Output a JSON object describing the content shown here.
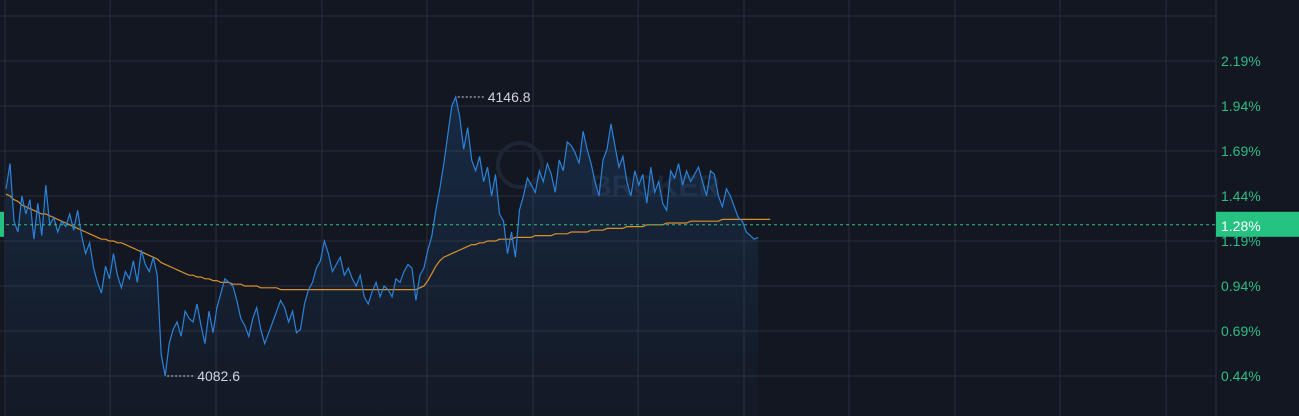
{
  "chart_data": {
    "type": "line",
    "y_unit": "percent change",
    "ylim": [
      0.36,
      2.4
    ],
    "y_ticks": [
      "2.19%",
      "1.94%",
      "1.69%",
      "1.44%",
      "1.19%",
      "0.94%",
      "0.69%",
      "0.44%"
    ],
    "y_tick_values": [
      2.19,
      1.94,
      1.69,
      1.44,
      1.19,
      0.94,
      0.69,
      0.44
    ],
    "current_value_label": "1.28%",
    "current_value": 1.28,
    "annotations": [
      {
        "text": "4146.8",
        "kind": "high",
        "y": 1.99
      },
      {
        "text": "4082.6",
        "kind": "low",
        "y": 0.44
      }
    ],
    "x_steps": 190,
    "grid": true,
    "series": [
      {
        "color": "#2b82d9",
        "values": [
          1.48,
          1.62,
          1.3,
          1.24,
          1.44,
          1.34,
          1.42,
          1.2,
          1.4,
          1.22,
          1.5,
          1.28,
          1.32,
          1.24,
          1.3,
          1.27,
          1.34,
          1.25,
          1.36,
          1.22,
          1.12,
          1.18,
          1.04,
          0.96,
          0.9,
          1.05,
          0.98,
          1.12,
          1.0,
          0.93,
          1.02,
          0.98,
          1.08,
          0.96,
          1.14,
          1.06,
          1.02,
          1.1,
          1.0,
          0.56,
          0.44,
          0.62,
          0.7,
          0.74,
          0.66,
          0.8,
          0.76,
          0.74,
          0.84,
          0.72,
          0.62,
          0.8,
          0.68,
          0.82,
          0.9,
          0.98,
          0.96,
          0.94,
          0.86,
          0.76,
          0.72,
          0.66,
          0.76,
          0.82,
          0.7,
          0.62,
          0.68,
          0.74,
          0.8,
          0.86,
          0.82,
          0.74,
          0.8,
          0.68,
          0.7,
          0.84,
          0.92,
          0.96,
          1.04,
          1.08,
          1.19,
          1.12,
          1.02,
          1.06,
          1.1,
          1.0,
          1.04,
          0.98,
          0.94,
          1.0,
          0.88,
          0.84,
          0.91,
          0.96,
          0.88,
          0.94,
          0.92,
          0.88,
          0.98,
          0.96,
          1.02,
          1.06,
          1.04,
          0.86,
          1.0,
          1.04,
          1.14,
          1.22,
          1.36,
          1.48,
          1.62,
          1.78,
          1.94,
          1.99,
          1.88,
          1.7,
          1.82,
          1.64,
          1.58,
          1.66,
          1.52,
          1.6,
          1.44,
          1.56,
          1.34,
          1.3,
          1.12,
          1.24,
          1.1,
          1.36,
          1.44,
          1.54,
          1.5,
          1.46,
          1.58,
          1.52,
          1.62,
          1.56,
          1.46,
          1.64,
          1.58,
          1.74,
          1.72,
          1.68,
          1.62,
          1.8,
          1.7,
          1.62,
          1.52,
          1.44,
          1.64,
          1.7,
          1.84,
          1.72,
          1.6,
          1.66,
          1.52,
          1.44,
          1.58,
          1.5,
          1.56,
          1.4,
          1.6,
          1.46,
          1.52,
          1.4,
          1.36,
          1.58,
          1.54,
          1.62,
          1.5,
          1.58,
          1.52,
          1.56,
          1.6,
          1.52,
          1.44,
          1.58,
          1.56,
          1.44,
          1.38,
          1.48,
          1.44,
          1.38,
          1.32,
          1.3,
          1.24,
          1.22,
          1.2,
          1.21
        ]
      },
      {
        "color": "#d9902c",
        "values": [
          1.45,
          1.44,
          1.42,
          1.41,
          1.39,
          1.38,
          1.37,
          1.36,
          1.35,
          1.34,
          1.34,
          1.33,
          1.32,
          1.31,
          1.3,
          1.29,
          1.28,
          1.27,
          1.26,
          1.25,
          1.24,
          1.23,
          1.22,
          1.21,
          1.2,
          1.2,
          1.19,
          1.19,
          1.18,
          1.18,
          1.17,
          1.16,
          1.15,
          1.14,
          1.13,
          1.12,
          1.11,
          1.1,
          1.09,
          1.07,
          1.06,
          1.05,
          1.04,
          1.03,
          1.02,
          1.01,
          1.0,
          1.0,
          0.99,
          0.99,
          0.98,
          0.98,
          0.97,
          0.97,
          0.96,
          0.96,
          0.96,
          0.95,
          0.95,
          0.95,
          0.94,
          0.94,
          0.94,
          0.94,
          0.93,
          0.93,
          0.93,
          0.93,
          0.93,
          0.92,
          0.92,
          0.92,
          0.92,
          0.92,
          0.92,
          0.92,
          0.92,
          0.92,
          0.92,
          0.92,
          0.92,
          0.92,
          0.92,
          0.92,
          0.92,
          0.92,
          0.92,
          0.92,
          0.92,
          0.92,
          0.92,
          0.92,
          0.92,
          0.92,
          0.92,
          0.92,
          0.92,
          0.92,
          0.92,
          0.92,
          0.92,
          0.92,
          0.92,
          0.92,
          0.93,
          0.94,
          0.97,
          1.01,
          1.05,
          1.08,
          1.1,
          1.11,
          1.12,
          1.13,
          1.14,
          1.15,
          1.16,
          1.17,
          1.17,
          1.18,
          1.18,
          1.19,
          1.19,
          1.19,
          1.2,
          1.2,
          1.2,
          1.2,
          1.21,
          1.21,
          1.21,
          1.21,
          1.21,
          1.22,
          1.22,
          1.22,
          1.22,
          1.22,
          1.23,
          1.23,
          1.23,
          1.23,
          1.24,
          1.24,
          1.24,
          1.24,
          1.24,
          1.25,
          1.25,
          1.25,
          1.25,
          1.26,
          1.26,
          1.26,
          1.26,
          1.26,
          1.27,
          1.27,
          1.27,
          1.27,
          1.27,
          1.28,
          1.28,
          1.28,
          1.28,
          1.28,
          1.29,
          1.29,
          1.29,
          1.29,
          1.29,
          1.29,
          1.3,
          1.3,
          1.3,
          1.3,
          1.3,
          1.3,
          1.3,
          1.3,
          1.31,
          1.31,
          1.31,
          1.31,
          1.31,
          1.31,
          1.31,
          1.31,
          1.31,
          1.31,
          1.31,
          1.31,
          1.31
        ]
      }
    ]
  },
  "watermark": "BROKER",
  "colors": {
    "background": "#131722",
    "grid": "#2a2e39",
    "tick_text": "#2ebd85",
    "current_line": "#2ebd85",
    "badge": "#26c281"
  }
}
